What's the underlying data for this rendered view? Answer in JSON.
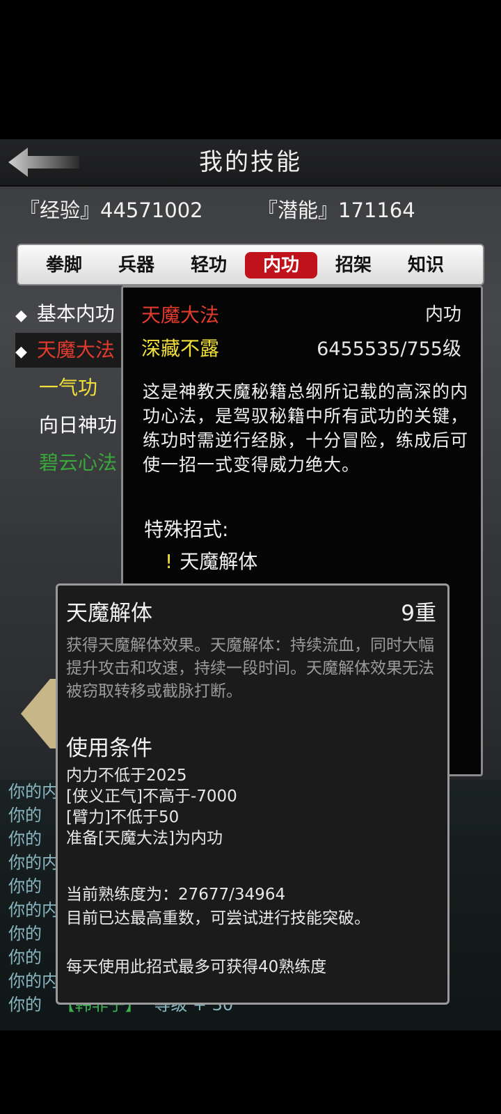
{
  "header": {
    "title": "我的技能",
    "back_icon": "back-arrow-icon"
  },
  "stats": {
    "exp": "『经验』44571002",
    "potential": "『潜能』171164"
  },
  "tabs": [
    {
      "label": "拳脚",
      "active": false
    },
    {
      "label": "兵器",
      "active": false
    },
    {
      "label": "轻功",
      "active": false
    },
    {
      "label": "内功",
      "active": true
    },
    {
      "label": "招架",
      "active": false
    },
    {
      "label": "知识",
      "active": false
    }
  ],
  "skills": [
    {
      "label": "基本内功",
      "visible_text": "基本内功"
    },
    {
      "label": "天魔大法",
      "visible_text": "天魔大法"
    },
    {
      "label": "一气功",
      "visible_text": "一气功"
    },
    {
      "label": "向日神功",
      "visible_text": "向日神功"
    },
    {
      "label": "碧云心法",
      "visible_text": "碧云心法"
    }
  ],
  "detail": {
    "name": "天魔大法",
    "type": "内功",
    "rank": "深藏不露",
    "level": "6455535/755级",
    "description": "这是神教天魔秘籍总纲所记载的高深的内功心法，是驾驭秘籍中所有武功的关键，练功时需逆行经脉，十分冒险，练成后可使一招一式变得威力绝大。",
    "special_title": "特殊招式:",
    "special_move_mark": "!",
    "special_move": "天魔解体"
  },
  "popup": {
    "name": "天魔解体",
    "tier": "9重",
    "description": "获得天魔解体效果。天魔解体：持续流血，同时大幅提升攻击和攻速，持续一段时间。天魔解体效果无法被窃取转移或截脉打断。",
    "conditions_title": "使用条件",
    "conditions": [
      "内力不低于2025",
      "[侠义正气]不高于-7000",
      "[臂力]不低于50",
      "准备[天魔大法]为内功"
    ],
    "proficiency": "当前熟练度为：27677/34964",
    "max_note": "目前已达最高重数，可尝试进行技能突破。",
    "daily_note": "每天使用此招式最多可获得40熟练度"
  },
  "log": {
    "lines": [
      "你的内",
      "你的",
      "你的",
      "你的内",
      "你的",
      "你的内",
      "你的",
      "你的",
      "你的内"
    ],
    "last_prefix": "你的",
    "last_highlight": "【韩非子】",
    "last_suffix": "等级 + 30"
  },
  "colors": {
    "active_tab": "#c0121a",
    "skill_red": "#e23b2e",
    "skill_yellow": "#f2e03a",
    "skill_green": "#3aa83a",
    "log_text": "#8ab7c2"
  }
}
